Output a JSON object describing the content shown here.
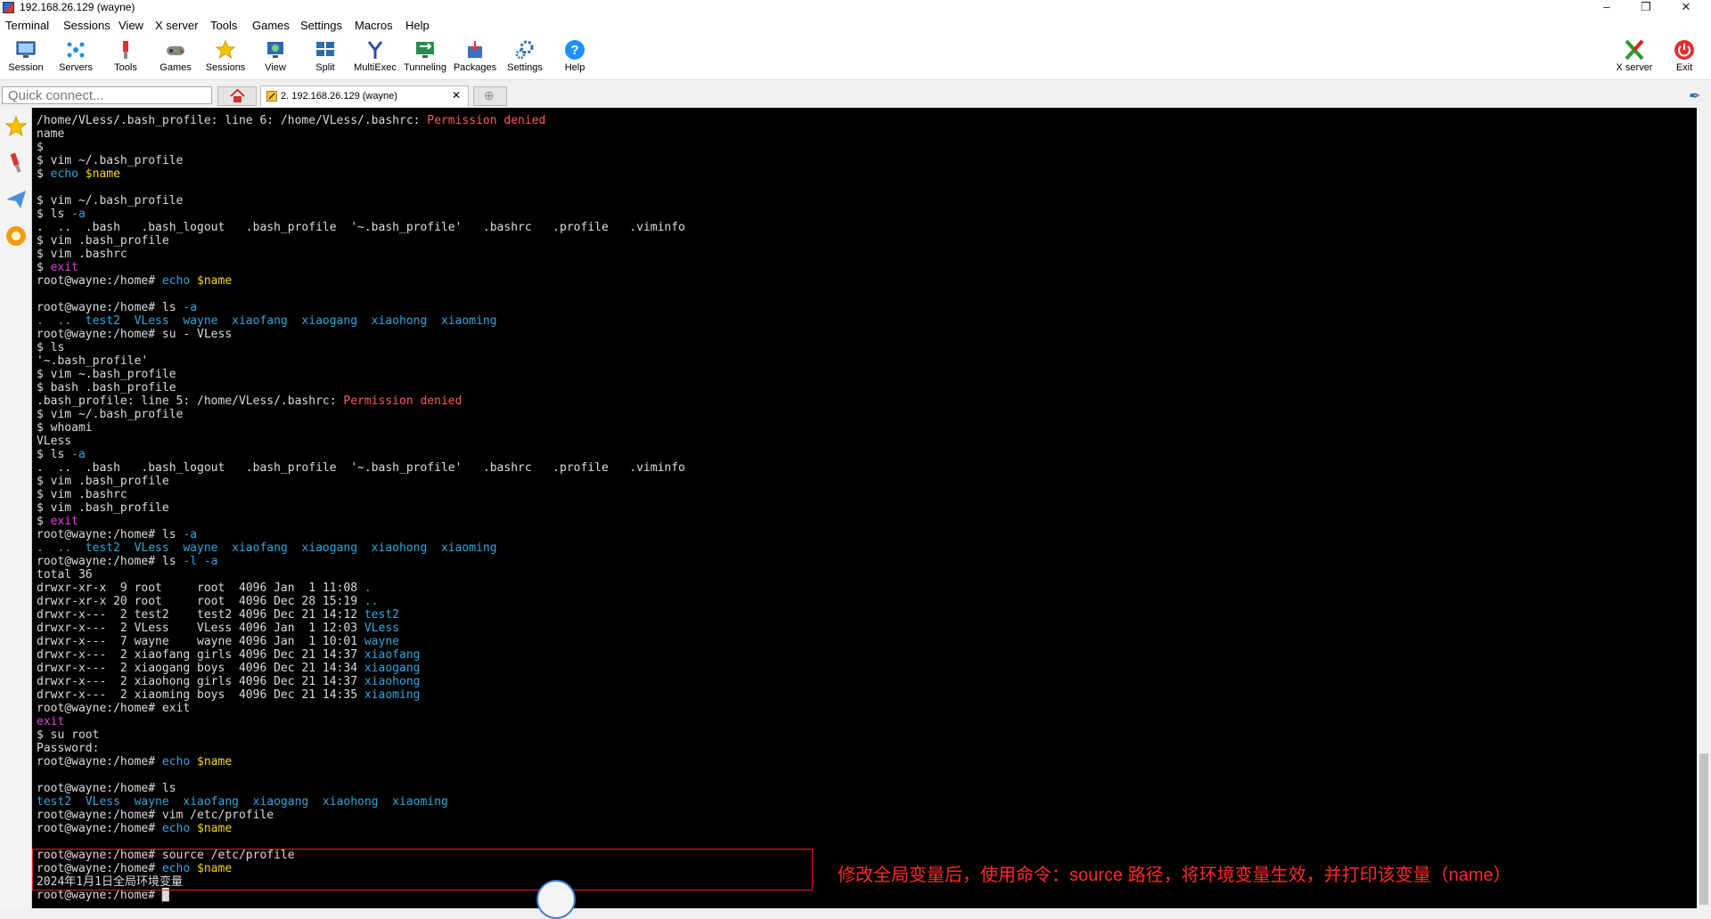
{
  "window": {
    "title": "192.168.26.129 (wayne)"
  },
  "menu": [
    "Terminal",
    "Sessions",
    "View",
    "X server",
    "Tools",
    "Games",
    "Settings",
    "Macros",
    "Help"
  ],
  "toolbar": {
    "session": "Session",
    "servers": "Servers",
    "tools": "Tools",
    "games": "Games",
    "sessions": "Sessions",
    "view": "View",
    "split": "Split",
    "multiexec": "MultiExec",
    "tunneling": "Tunneling",
    "packages": "Packages",
    "settings": "Settings",
    "help": "Help",
    "xserver": "X server",
    "exit": "Exit"
  },
  "quick_connect": {
    "placeholder": "Quick connect..."
  },
  "tab": {
    "label": "2. 192.168.26.129 (wayne)"
  },
  "terminal_lines": [
    [
      [
        "/home/VLess/.bash_profile: line 6: /home/VLess/.bashrc: ",
        ""
      ],
      [
        "Permission denied",
        "red"
      ]
    ],
    [
      [
        "name",
        ""
      ]
    ],
    [
      [
        "$",
        ""
      ]
    ],
    [
      [
        "$ vim ~/.bash_profile",
        ""
      ]
    ],
    [
      [
        "$ ",
        ""
      ],
      [
        "echo",
        "cyan"
      ],
      [
        " ",
        ""
      ],
      [
        "$name",
        "yel"
      ]
    ],
    [
      [
        "",
        ""
      ]
    ],
    [
      [
        "$ vim ~/.bash_profile",
        ""
      ]
    ],
    [
      [
        "$ ls ",
        ""
      ],
      [
        "-a",
        "cyan"
      ]
    ],
    [
      [
        ".  ..  .bash   .bash_logout   .bash_profile  '~.bash_profile'   .bashrc   .profile   .viminfo",
        ""
      ]
    ],
    [
      [
        "$ vim .bash_profile",
        ""
      ]
    ],
    [
      [
        "$ vim .bashrc",
        ""
      ]
    ],
    [
      [
        "$ ",
        ""
      ],
      [
        "exit",
        "mag"
      ]
    ],
    [
      [
        "root@wayne:/home# ",
        ""
      ],
      [
        "echo",
        "cyan"
      ],
      [
        " ",
        ""
      ],
      [
        "$name",
        "yel"
      ]
    ],
    [
      [
        "",
        ""
      ]
    ],
    [
      [
        "root@wayne:/home# ls ",
        ""
      ],
      [
        "-a",
        "cyan"
      ]
    ],
    [
      [
        ".  ..  test2  VLess  wayne  xiaofang  xiaogang  xiaohong  xiaoming",
        "cyan"
      ]
    ],
    [
      [
        "root@wayne:/home# su - VLess",
        ""
      ]
    ],
    [
      [
        "$ ls",
        ""
      ]
    ],
    [
      [
        "'~.bash_profile'",
        ""
      ]
    ],
    [
      [
        "$ vim ~.bash_profile",
        ""
      ]
    ],
    [
      [
        "$ bash .bash_profile",
        ""
      ]
    ],
    [
      [
        ".bash_profile: line 5: /home/VLess/.bashrc: ",
        ""
      ],
      [
        "Permission denied",
        "red"
      ]
    ],
    [
      [
        "$ vim ~/.bash_profile",
        ""
      ]
    ],
    [
      [
        "$ whoami",
        ""
      ]
    ],
    [
      [
        "VLess",
        ""
      ]
    ],
    [
      [
        "$ ls ",
        ""
      ],
      [
        "-a",
        "cyan"
      ]
    ],
    [
      [
        ".  ..  .bash   .bash_logout   .bash_profile  '~.bash_profile'   .bashrc   .profile   .viminfo",
        ""
      ]
    ],
    [
      [
        "$ vim .bash_profile",
        ""
      ]
    ],
    [
      [
        "$ vim .bashrc",
        ""
      ]
    ],
    [
      [
        "$ vim .bash_profile",
        ""
      ]
    ],
    [
      [
        "$ ",
        ""
      ],
      [
        "exit",
        "mag"
      ]
    ],
    [
      [
        "root@wayne:/home# ls ",
        ""
      ],
      [
        "-a",
        "cyan"
      ]
    ],
    [
      [
        ".  ..  test2  VLess  wayne  xiaofang  xiaogang  xiaohong  xiaoming",
        "cyan"
      ]
    ],
    [
      [
        "root@wayne:/home# ls ",
        ""
      ],
      [
        "-l -a",
        "cyan"
      ]
    ],
    [
      [
        "total 36",
        ""
      ]
    ],
    [
      [
        "drwxr-xr-x  9 root     root  4096 Jan  1 11:08 ",
        ""
      ],
      [
        ".",
        "cyan"
      ]
    ],
    [
      [
        "drwxr-xr-x 20 root     root  4096 Dec 28 15:19 ",
        ""
      ],
      [
        "..",
        "cyan"
      ]
    ],
    [
      [
        "drwxr-x---  2 test2    test2 4096 Dec 21 14:12 ",
        ""
      ],
      [
        "test2",
        "cyan"
      ]
    ],
    [
      [
        "drwxr-x---  2 VLess    VLess 4096 Jan  1 12:03 ",
        ""
      ],
      [
        "VLess",
        "cyan"
      ]
    ],
    [
      [
        "drwxr-x---  7 wayne    wayne 4096 Jan  1 10:01 ",
        ""
      ],
      [
        "wayne",
        "cyan"
      ]
    ],
    [
      [
        "drwxr-x---  2 xiaofang girls 4096 Dec 21 14:37 ",
        ""
      ],
      [
        "xiaofang",
        "cyan"
      ]
    ],
    [
      [
        "drwxr-x---  2 xiaogang boys  4096 Dec 21 14:34 ",
        ""
      ],
      [
        "xiaogang",
        "cyan"
      ]
    ],
    [
      [
        "drwxr-x---  2 xiaohong girls 4096 Dec 21 14:37 ",
        ""
      ],
      [
        "xiaohong",
        "cyan"
      ]
    ],
    [
      [
        "drwxr-x---  2 xiaoming boys  4096 Dec 21 14:35 ",
        ""
      ],
      [
        "xiaoming",
        "cyan"
      ]
    ],
    [
      [
        "root@wayne:/home# exit",
        ""
      ]
    ],
    [
      [
        "exit",
        "mag"
      ]
    ],
    [
      [
        "$ su root",
        ""
      ]
    ],
    [
      [
        "Password:",
        ""
      ]
    ],
    [
      [
        "root@wayne:/home# ",
        ""
      ],
      [
        "echo",
        "cyan"
      ],
      [
        " ",
        ""
      ],
      [
        "$name",
        "yel"
      ]
    ],
    [
      [
        "",
        ""
      ]
    ],
    [
      [
        "root@wayne:/home# ls",
        ""
      ]
    ],
    [
      [
        "test2  VLess  wayne  xiaofang  xiaogang  xiaohong  xiaoming",
        "cyan"
      ]
    ],
    [
      [
        "root@wayne:/home# vim /etc/profile",
        ""
      ]
    ],
    [
      [
        "root@wayne:/home# ",
        ""
      ],
      [
        "echo",
        "cyan"
      ],
      [
        " ",
        ""
      ],
      [
        "$name",
        "yel"
      ]
    ],
    [
      [
        "",
        ""
      ]
    ],
    [
      [
        "root@wayne:/home# source /etc/profile",
        ""
      ]
    ],
    [
      [
        "root@wayne:/home# ",
        ""
      ],
      [
        "echo",
        "cyan"
      ],
      [
        " ",
        ""
      ],
      [
        "$name",
        "yel"
      ]
    ],
    [
      [
        "2024年1月1日全局环境变量",
        ""
      ]
    ],
    [
      [
        "root@wayne:/home# ",
        ""
      ],
      [
        "█",
        ""
      ]
    ]
  ],
  "annotation": {
    "text": "修改全局变量后，使用命令：source 路径，将环境变量生效，并打印该变量（name）"
  },
  "colors": {
    "terminal_bg": "#000000",
    "error": "#ff5a5a",
    "keyword": "#2ea8e0",
    "variable": "#f5d80b",
    "exit": "#e43ee4",
    "annotation": "#ff2a2a"
  }
}
